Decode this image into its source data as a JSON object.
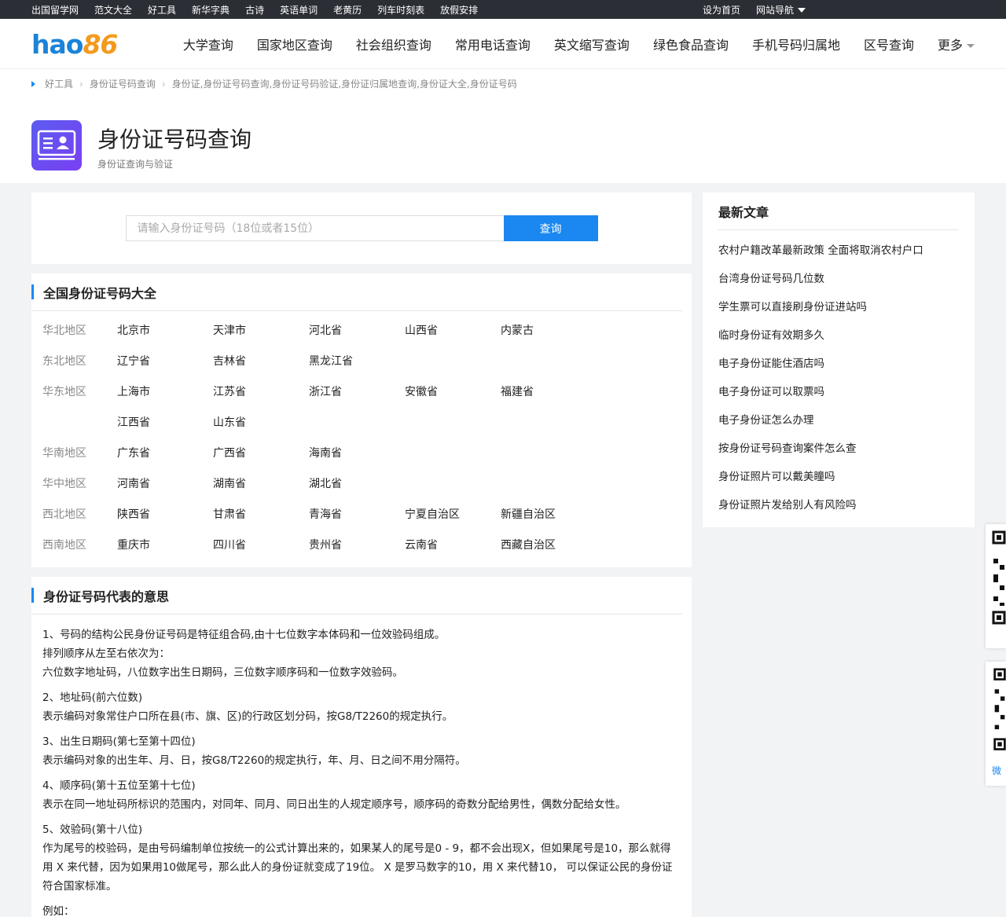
{
  "topbar": {
    "links": [
      "出国留学网",
      "范文大全",
      "好工具",
      "新华字典",
      "古诗",
      "英语单词",
      "老黄历",
      "列车时刻表",
      "放假安排"
    ],
    "set_home": "设为首页",
    "site_nav": "网站导航"
  },
  "logo": {
    "hao": "hao",
    "num": "86"
  },
  "nav": {
    "items": [
      "大学查询",
      "国家地区查询",
      "社会组织查询",
      "常用电话查询",
      "英文缩写查询",
      "绿色食品查询",
      "手机号码归属地",
      "区号查询"
    ],
    "more": "更多"
  },
  "breadcrumb": [
    "好工具",
    "身份证号码查询",
    "身份证,身份证号码查询,身份证号码验证,身份证归属地查询,身份证大全,身份证号码"
  ],
  "page": {
    "title": "身份证号码查询",
    "subtitle": "身份证查询与验证"
  },
  "search": {
    "placeholder": "请输入身份证号码（18位或者15位）",
    "button": "查询"
  },
  "regions_title": "全国身份证号码大全",
  "regions": [
    {
      "name": "华北地区",
      "provinces": [
        "北京市",
        "天津市",
        "河北省",
        "山西省",
        "内蒙古"
      ]
    },
    {
      "name": "东北地区",
      "provinces": [
        "辽宁省",
        "吉林省",
        "黑龙江省"
      ]
    },
    {
      "name": "华东地区",
      "provinces": [
        "上海市",
        "江苏省",
        "浙江省",
        "安徽省",
        "福建省",
        "江西省",
        "山东省"
      ]
    },
    {
      "name": "华南地区",
      "provinces": [
        "广东省",
        "广西省",
        "海南省"
      ]
    },
    {
      "name": "华中地区",
      "provinces": [
        "河南省",
        "湖南省",
        "湖北省"
      ]
    },
    {
      "name": "西北地区",
      "provinces": [
        "陕西省",
        "甘肃省",
        "青海省",
        "宁夏自治区",
        "新疆自治区"
      ]
    },
    {
      "name": "西南地区",
      "provinces": [
        "重庆市",
        "四川省",
        "贵州省",
        "云南省",
        "西藏自治区"
      ]
    }
  ],
  "meaning": {
    "title": "身份证号码代表的意思",
    "paragraphs": [
      [
        "1、号码的结构公民身份证号码是特征组合码,由十七位数字本体码和一位效验码组成。",
        "排列顺序从左至右依次为：",
        "六位数字地址码，八位数字出生日期码，三位数字顺序码和一位数字效验码。"
      ],
      [
        "2、地址码(前六位数)",
        "表示编码对象常住户口所在县(市、旗、区)的行政区划分码，按G8/T2260的规定执行。"
      ],
      [
        "3、出生日期码(第七至第十四位)",
        "表示编码对象的出生年、月、日，按G8/T2260的规定执行，年、月、日之间不用分隔符。"
      ],
      [
        "4、顺序码(第十五位至第十七位)",
        "表示在同一地址码所标识的范围内，对同年、同月、同日出生的人规定顺序号，顺序码的奇数分配给男性，偶数分配给女性。"
      ],
      [
        "5、效验码(第十八位)",
        "作为尾号的校验码，是由号码编制单位按统一的公式计算出来的，如果某人的尾号是0 - 9，都不会出现X，但如果尾号是10，那么就得用 X 来代替，因为如果用10做尾号，那么此人的身份证就变成了19位。 X 是罗马数字的10，用 X 来代替10， 可以保证公民的身份证符合国家标准。"
      ],
      [
        "例如："
      ]
    ]
  },
  "news": {
    "title": "最新文章",
    "items": [
      "农村户籍改革最新政策 全面将取消农村户口",
      "台湾身份证号码几位数",
      "学生票可以直接刷身份证进站吗",
      "临时身份证有效期多久",
      "电子身份证能住酒店吗",
      "电子身份证可以取票吗",
      "电子身份证怎么办理",
      "按身份证号码查询案件怎么查",
      "身份证照片可以戴美瞳吗",
      "身份证照片发给别人有风险吗"
    ]
  },
  "float": {
    "label": "微"
  },
  "colors": {
    "accent": "#1a88f0",
    "topbar": "#2b2e35",
    "logo_blue": "#1b83d8",
    "logo_orange": "#f39a1c"
  }
}
